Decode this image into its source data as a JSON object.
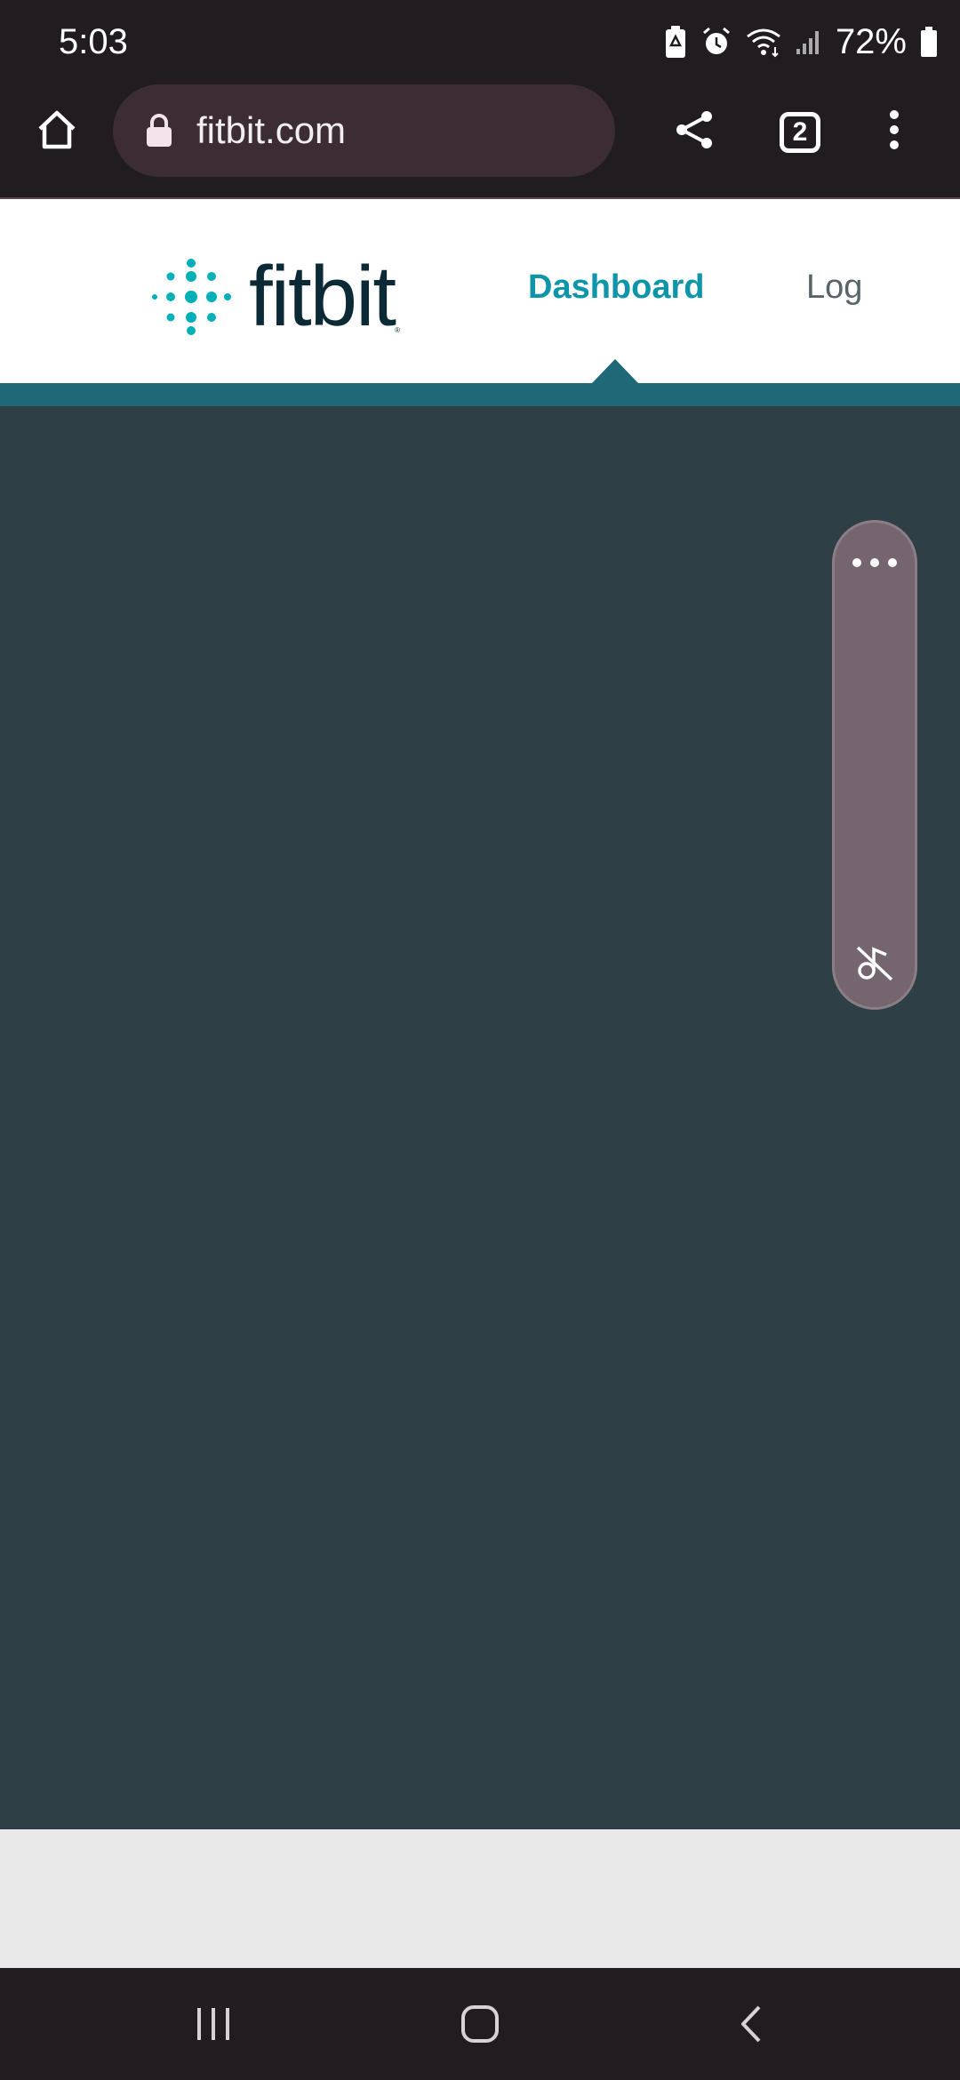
{
  "status_bar": {
    "time": "5:03",
    "battery_percent": "72%",
    "icons": [
      "battery-saver-icon",
      "alarm-icon",
      "wifi-icon",
      "signal-icon",
      "battery-icon"
    ]
  },
  "browser": {
    "url": "fitbit.com",
    "tab_count": "2",
    "icons": [
      "home-icon",
      "lock-icon",
      "share-icon",
      "tabs-icon",
      "more-vert-icon"
    ]
  },
  "site": {
    "logo_text": "fitbit",
    "logo_tm": "®",
    "nav": {
      "dashboard": "Dashboard",
      "log": "Log",
      "active": "dashboard"
    }
  },
  "floating_panel": {
    "icons": [
      "more-horiz-icon",
      "mute-icon"
    ]
  },
  "colors": {
    "accent": "#0e95aa",
    "nav_strip": "#1e6878",
    "content_bg": "#2f3f46",
    "logo_mark": "#00b0b9",
    "logo_text": "#0c2a36"
  },
  "system_nav": {
    "icons": [
      "recents-icon",
      "home-button-icon",
      "back-icon"
    ]
  }
}
